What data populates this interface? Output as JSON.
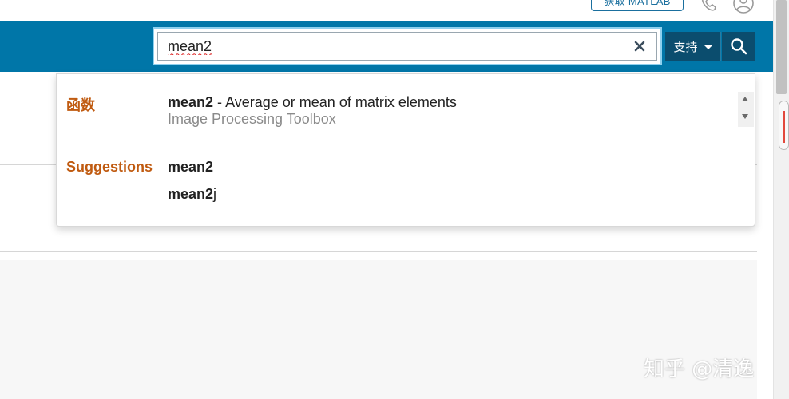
{
  "top": {
    "get_matlab_label": "获取 MATLAB"
  },
  "search": {
    "value": "mean2",
    "support_label": "支持"
  },
  "dropdown": {
    "functions_label": "函数",
    "function_result": {
      "name": "mean2",
      "separator": " - ",
      "description": "Average or mean of matrix elements",
      "toolbox": "Image Processing Toolbox"
    },
    "suggestions_label": "Suggestions",
    "suggestions": [
      {
        "bold": "mean2",
        "rest": ""
      },
      {
        "bold": "mean2",
        "rest": "j"
      }
    ]
  },
  "watermark": "知乎 @清逸",
  "colors": {
    "header_blue": "#0076a8",
    "button_dark": "#0b4d6e",
    "section_orange": "#c05b11"
  },
  "icons": [
    "phone-icon",
    "user-icon",
    "clear-icon",
    "caret-down-icon",
    "search-icon"
  ]
}
